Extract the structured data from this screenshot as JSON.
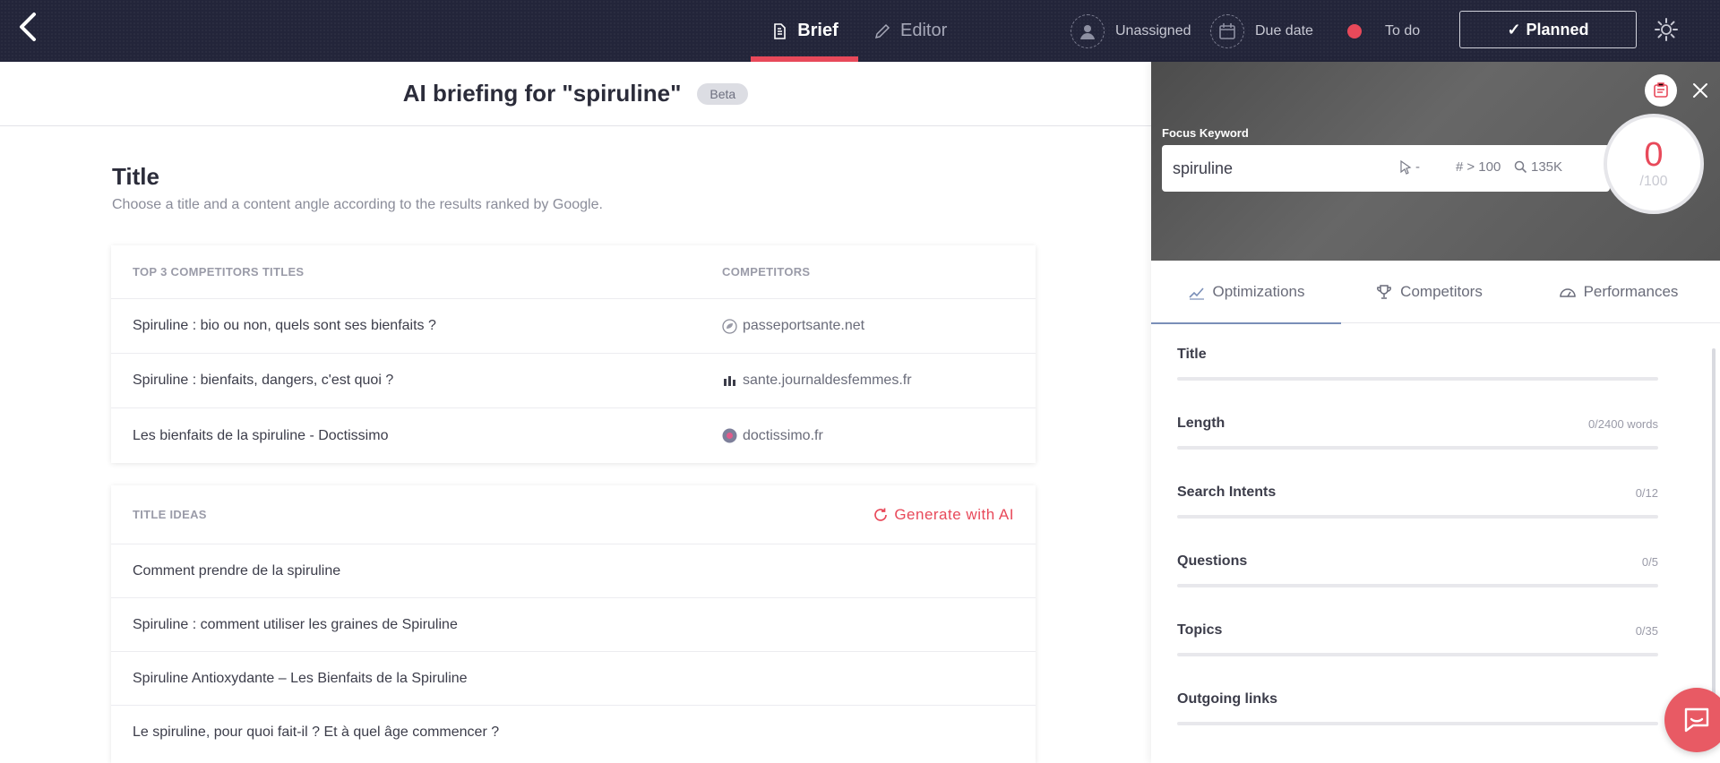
{
  "topbar": {
    "tabs": [
      {
        "label": "Brief",
        "icon": "document-icon",
        "active": true
      },
      {
        "label": "Editor",
        "icon": "pencil-icon",
        "active": false
      }
    ],
    "assignee": "Unassigned",
    "due_date": "Due date",
    "status": "To do",
    "status_color": "#e8495a",
    "planned_label": "Planned",
    "accent": "#e8495a"
  },
  "brief": {
    "title": "AI briefing for \"spiruline\"",
    "badge": "Beta"
  },
  "title_section": {
    "heading": "Title",
    "subtitle": "Choose a title and a content angle according to the results ranked by Google.",
    "competitors_table": {
      "col1": "TOP 3 COMPETITORS TITLES",
      "col2": "COMPETITORS",
      "rows": [
        {
          "title": "Spiruline : bio ou non, quels sont ses bienfaits ?",
          "domain": "passeportsante.net"
        },
        {
          "title": "Spiruline : bienfaits, dangers, c'est quoi ?",
          "domain": "sante.journaldesfemmes.fr"
        },
        {
          "title": "Les bienfaits de la spiruline - Doctissimo",
          "domain": "doctissimo.fr"
        }
      ]
    },
    "ideas": {
      "header": "TITLE IDEAS",
      "generate_label": "Generate with AI",
      "rows": [
        "Comment prendre de la spiruline",
        "Spiruline : comment utiliser les graines de Spiruline",
        "Spiruline Antioxydante – Les Bienfaits de la Spiruline",
        "Le spiruline, pour quoi fait-il ? Et à quel âge commencer ?"
      ]
    }
  },
  "panel": {
    "focus_label": "Focus Keyword",
    "keyword": "spiruline",
    "stat_click": "-",
    "stat_rank": "> 100",
    "stat_volume": "135K",
    "score": "0",
    "score_max": "/100",
    "tabs": [
      {
        "label": "Optimizations",
        "icon": "trend-icon",
        "active": true
      },
      {
        "label": "Competitors",
        "icon": "trophy-icon",
        "active": false
      },
      {
        "label": "Performances",
        "icon": "gauge-icon",
        "active": false
      }
    ],
    "items": [
      {
        "label": "Title",
        "value": "",
        "progress": 0
      },
      {
        "label": "Length",
        "value": "0/2400 words",
        "progress": 0
      },
      {
        "label": "Search Intents",
        "value": "0/12",
        "progress": 0
      },
      {
        "label": "Questions",
        "value": "0/5",
        "progress": 0
      },
      {
        "label": "Topics",
        "value": "0/35",
        "progress": 0
      },
      {
        "label": "Outgoing links",
        "value": "",
        "progress": 0
      }
    ]
  }
}
